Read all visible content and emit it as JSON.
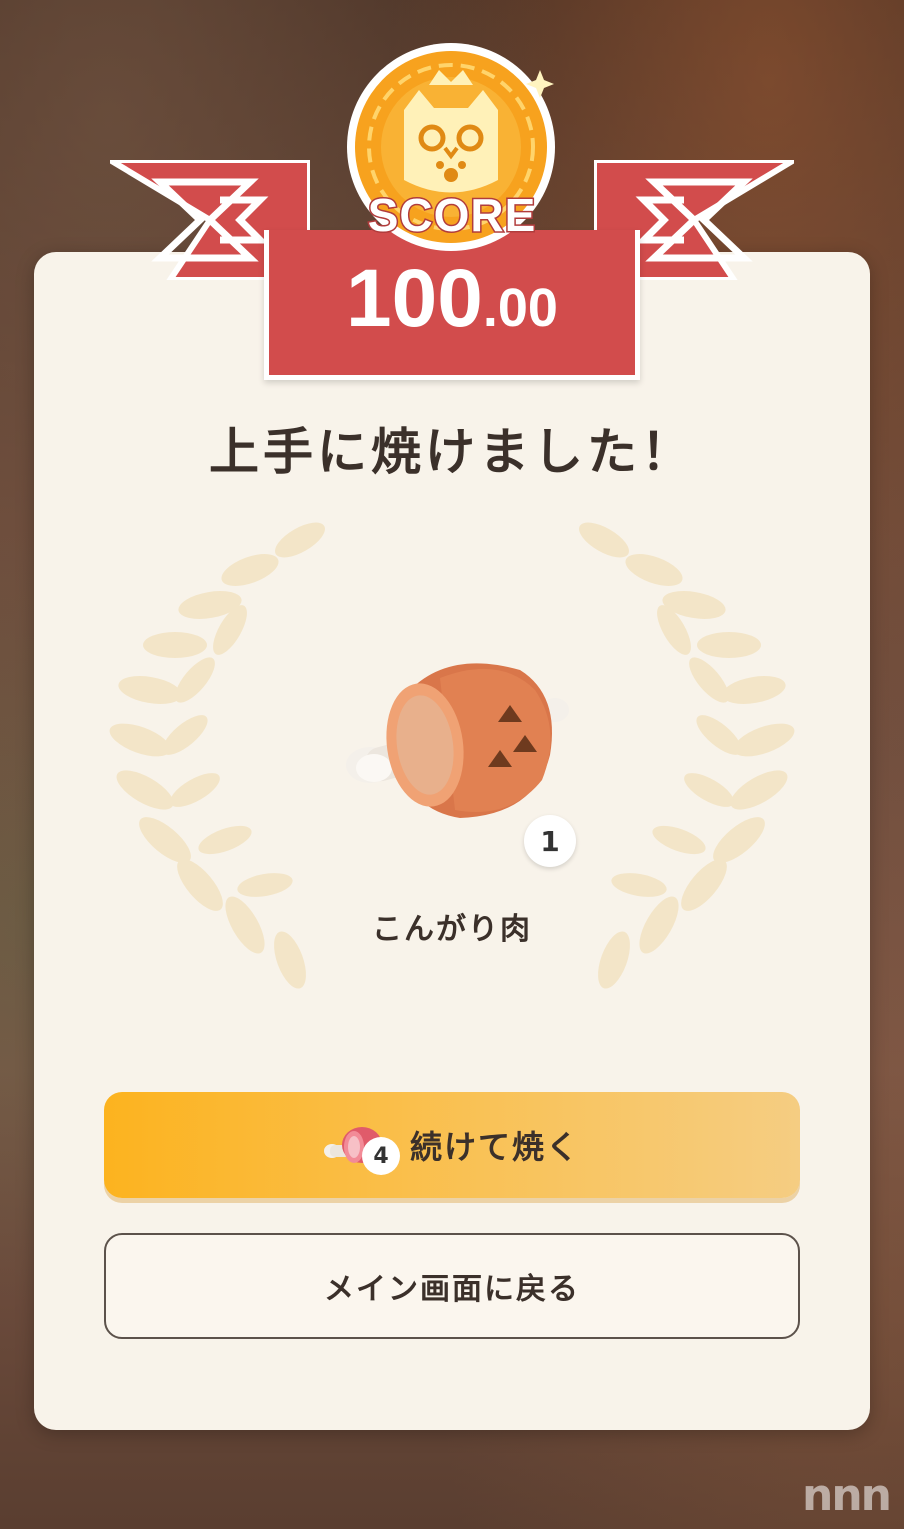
{
  "result": {
    "score_label": "SCORE",
    "score_integer": "100",
    "score_decimal": ".00",
    "title": "上手に焼けました！"
  },
  "reward": {
    "item_name": "こんがり肉",
    "item_count": "1",
    "item_icon": "well-done-steak-icon"
  },
  "buttons": {
    "continue_label": "続けて焼く",
    "continue_cost": "4",
    "continue_icon": "raw-meat-icon",
    "main_menu_label": "メイン画面に戻る"
  },
  "watermark": "nnn",
  "colors": {
    "banner_red": "#d24c4c",
    "coin_orange": "#f7a21e",
    "card_bg": "#f8f3ea",
    "button_orange": "#fcb31f"
  }
}
